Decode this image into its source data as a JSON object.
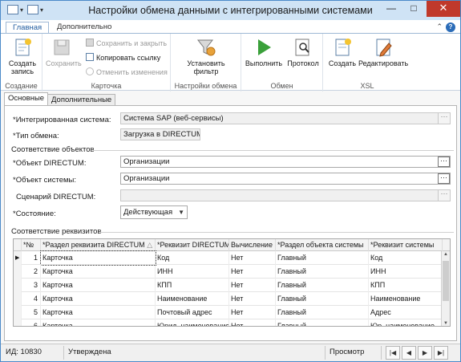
{
  "window": {
    "title": "Настройки обмена данными с интегрированными системами",
    "minimize": "—",
    "maximize": "□",
    "close": "✕"
  },
  "ribbon_tabs": [
    "Главная",
    "Дополнительно"
  ],
  "ribbon": {
    "groups": {
      "create": {
        "label": "Создание",
        "btn": "Создать запись"
      },
      "card": {
        "label": "Карточка",
        "save": "Сохранить",
        "save_close": "Сохранить и закрыть",
        "copy_link": "Копировать ссылку",
        "cancel_changes": "Отменить изменения"
      },
      "settings": {
        "label": "Настройки обмена",
        "btn": "Установить фильтр"
      },
      "exchange": {
        "label": "Обмен",
        "run": "Выполнить",
        "log": "Протокол"
      },
      "xsl": {
        "label": "XSL",
        "create": "Создать",
        "edit": "Редактировать"
      }
    }
  },
  "page_tabs": [
    "Основные",
    "Дополнительные"
  ],
  "form": {
    "system_label": "*Интегрированная система:",
    "system_value": "Система SAP (веб-сервисы)",
    "type_label": "*Тип обмена:",
    "type_value": "Загрузка в DIRECTUM",
    "objects_title": "Соответствие объектов",
    "dir_object_label": "*Объект DIRECTUM:",
    "dir_object_value": "Организации",
    "sys_object_label": "*Объект системы:",
    "sys_object_value": "Организации",
    "scenario_label": "Сценарий DIRECTUM:",
    "scenario_value": "",
    "state_label": "*Состояние:",
    "state_value": "Действующая",
    "attrs_title": "Соответствие реквизитов",
    "ellipsis": "···"
  },
  "grid": {
    "columns": [
      "*№",
      "*Раздел реквизита DIRECTUM",
      "*Реквизит DIRECTUM",
      "Вычисление",
      "*Раздел объекта системы",
      "*Реквизит системы"
    ],
    "rows": [
      [
        "1",
        "Карточка",
        "Код",
        "Нет",
        "Главный",
        "Код"
      ],
      [
        "2",
        "Карточка",
        "ИНН",
        "Нет",
        "Главный",
        "ИНН"
      ],
      [
        "3",
        "Карточка",
        "КПП",
        "Нет",
        "Главный",
        "КПП"
      ],
      [
        "4",
        "Карточка",
        "Наименование",
        "Нет",
        "Главный",
        "Наименование"
      ],
      [
        "5",
        "Карточка",
        "Почтовый адрес",
        "Нет",
        "Главный",
        "Адрес"
      ],
      [
        "6",
        "Карточка",
        "Юрид. наименование",
        "Нет",
        "Главный",
        "Юр. наименование"
      ]
    ]
  },
  "status": {
    "id": "ИД: 10830",
    "state": "Утверждена",
    "mode": "Просмотр"
  }
}
